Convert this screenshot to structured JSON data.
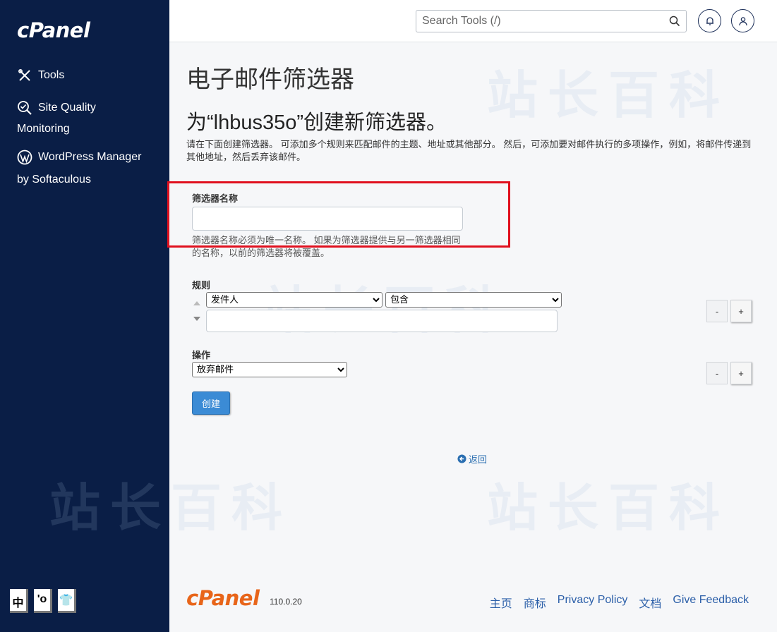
{
  "sidebar": {
    "logo": "cPanel",
    "items": [
      {
        "label": "Tools",
        "icon": "tools-icon"
      },
      {
        "label": "Site Quality",
        "label2": "Monitoring",
        "icon": "site-quality-icon"
      },
      {
        "label": "WordPress Manager",
        "label2": "by Softaculous",
        "icon": "wordpress-icon"
      }
    ],
    "lang": [
      "中",
      "'o",
      "👕"
    ]
  },
  "topbar": {
    "search_placeholder": "Search Tools (/)"
  },
  "main": {
    "title": "电子邮件筛选器",
    "subtitle": "为“lhbus35o”创建新筛选器。",
    "intro": "请在下面创建筛选器。 可添加多个规则来匹配邮件的主题、地址或其他部分。 然后，可添加要对邮件执行的多项操作，例如，将邮件传递到其他地址，然后丢弃该邮件。",
    "filter_name_label": "筛选器名称",
    "filter_name_value": "",
    "filter_name_help": "筛选器名称必须为唯一名称。 如果为筛选器提供与另一筛选器相同的名称，以前的筛选器将被覆盖。",
    "rules_label": "规则",
    "rule_field": "发件人",
    "rule_operator": "包含",
    "rule_value": "",
    "minus_label": "-",
    "plus_label": "+",
    "actions_label": "操作",
    "action_value": "放弃邮件",
    "create_label": "创建",
    "back_label": "返回"
  },
  "footer": {
    "logo": "cPanel",
    "version": "110.0.20",
    "links": [
      "主页",
      "商标",
      "Privacy Policy",
      "文档",
      "Give Feedback"
    ]
  },
  "watermark": "站长百科",
  "colors": {
    "sidebar_bg": "#0a1e46",
    "accent": "#3b8bd5",
    "highlight": "#e0101e",
    "footer_logo": "#e8651a"
  }
}
